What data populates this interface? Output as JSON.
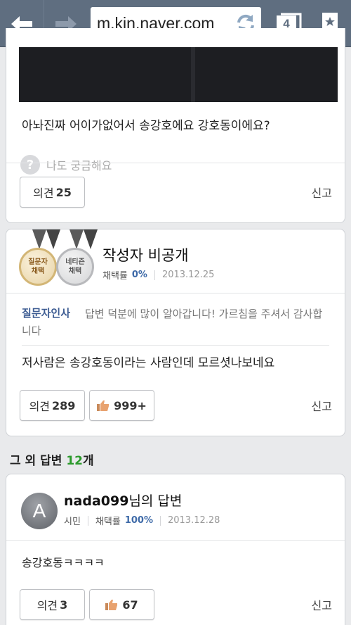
{
  "browser": {
    "url": "m.kin.naver.com",
    "tab_count": "4"
  },
  "card1": {
    "question": "아놔진짜 어이가없어서 송강호에요 강호동이에요?",
    "curious_label": "나도 궁금해요",
    "opinion_label": "의견",
    "opinion_count": "25",
    "report_label": "신고"
  },
  "card2": {
    "medal_gold": [
      "질문자",
      "채택"
    ],
    "medal_silver": [
      "네티즌",
      "채택"
    ],
    "author": "작성자 비공개",
    "adoption_label": "채택률",
    "adoption_rate": "0%",
    "date": "2013.12.25",
    "greeting_title": "질문자인사",
    "greeting_body": "답변 덕분에 많이 알아갑니다! 가르침을 주셔서 감사합니다",
    "answer": "저사람은 송강호동이라는 사람인데 모르셧나보네요",
    "opinion_label": "의견",
    "opinion_count": "289",
    "like_count": "999+",
    "report_label": "신고"
  },
  "others": {
    "prefix": "그 외 답변 ",
    "count": "12",
    "suffix": "개"
  },
  "card3": {
    "avatar_letter": "A",
    "username": "nada099",
    "name_suffix": "님의 답변",
    "rank": "시민",
    "adoption_label": "채택률",
    "adoption_rate": "100%",
    "date": "2013.12.28",
    "answer": "송강호동ㅋㅋㅋㅋ",
    "opinion_label": "의견",
    "opinion_count": "3",
    "like_count": "67",
    "report_label": "신고"
  },
  "colors": {
    "toolbar": "#5f6e80",
    "link_blue": "#3e5d93",
    "count_green": "#2b9a2b"
  }
}
